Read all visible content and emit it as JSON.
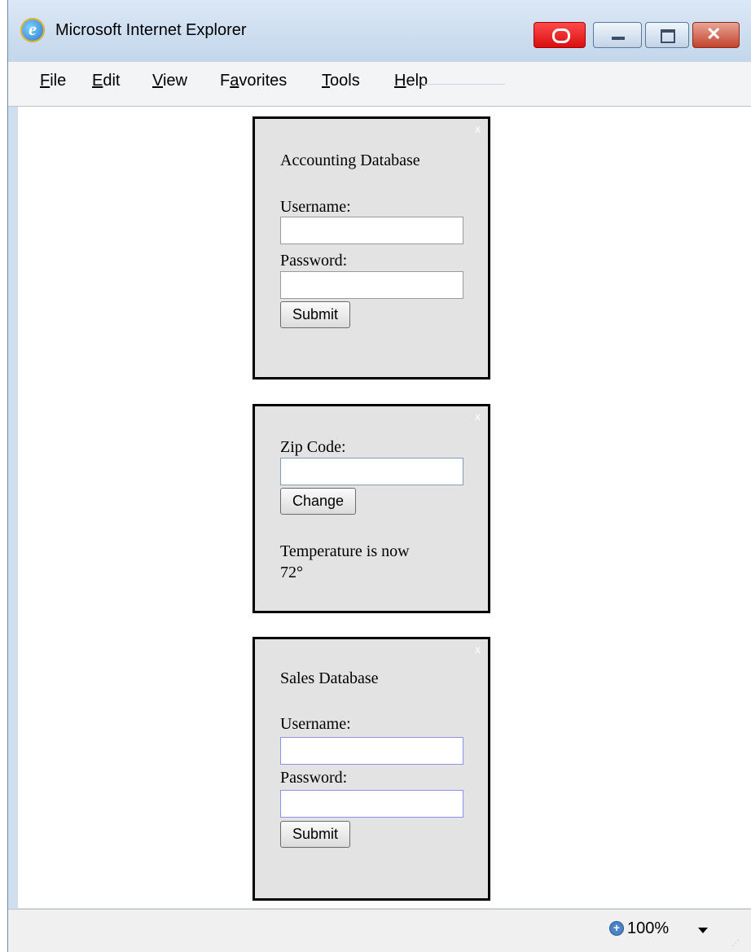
{
  "window": {
    "title": "Microsoft Internet Explorer",
    "icon": "ie-logo-icon",
    "controls": [
      "record-icon",
      "minimize-icon",
      "maximize-icon",
      "close-icon"
    ]
  },
  "menu": [
    {
      "access_key": "F",
      "rest": "ile"
    },
    {
      "access_key": "E",
      "rest": "dit"
    },
    {
      "access_key": "V",
      "rest": "iew"
    },
    {
      "pre": "F",
      "access_key": "a",
      "rest": "vorites"
    },
    {
      "access_key": "T",
      "rest": "ools"
    },
    {
      "access_key": "H",
      "rest": "elp"
    }
  ],
  "widgets": {
    "accounting": {
      "close_label": "x",
      "title": "Accounting Database",
      "username_label": "Username:",
      "username_value": "",
      "password_label": "Password:",
      "password_value": "",
      "submit_label": "Submit"
    },
    "weather": {
      "close_label": "x",
      "zip_label": "Zip Code:",
      "zip_value": "",
      "change_label": "Change",
      "temperature_line1": "Temperature is now",
      "temperature_line2": "72°"
    },
    "sales": {
      "close_label": "x",
      "title": "Sales Database",
      "username_label": "Username:",
      "username_value": "",
      "password_label": "Password:",
      "password_value": "",
      "submit_label": "Submit"
    }
  },
  "statusbar": {
    "zoom_icon": "zoom-in-icon",
    "zoom_level": "100%"
  },
  "colors": {
    "record_button": "#e81818",
    "close_button": "#c4422c",
    "widget_background": "#e3e3e3",
    "widget_border": "#000000"
  }
}
